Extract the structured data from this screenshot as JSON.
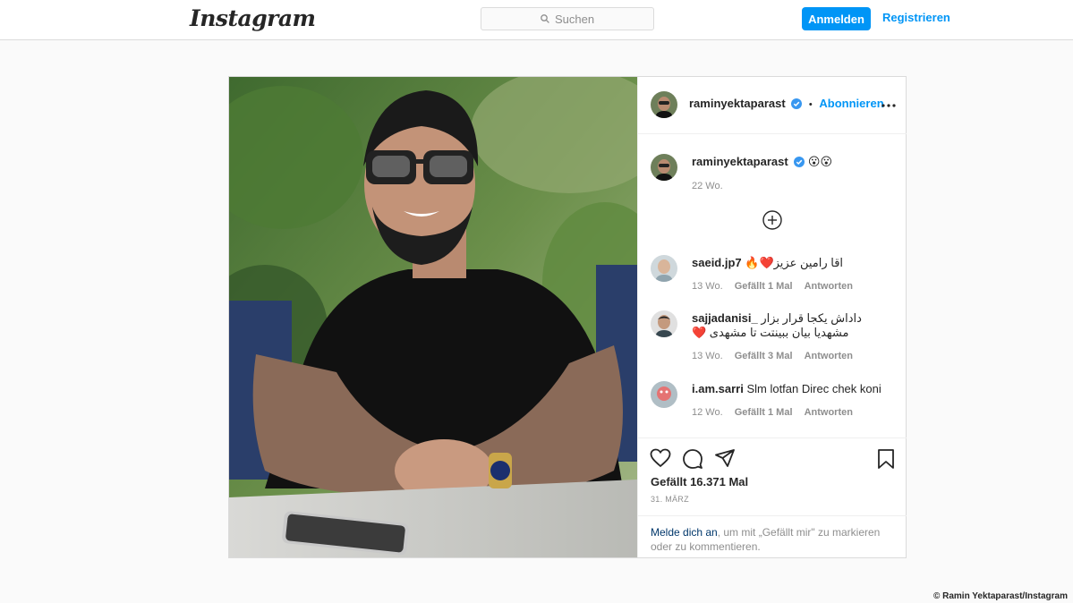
{
  "header": {
    "logo": "Instagram",
    "search_placeholder": "Suchen",
    "login_label": "Anmelden",
    "register_label": "Registrieren"
  },
  "post": {
    "author": "raminyektaparast",
    "follow_label": "Abonnieren",
    "caption_emojis": "😮😮",
    "caption_age": "22 Wo.",
    "comments": [
      {
        "user": "saeid.jp7",
        "text": "اقا رامین عزیز❤️🔥",
        "age": "13 Wo.",
        "likes": "Gefällt 1 Mal",
        "reply": "Antworten"
      },
      {
        "user": "sajjadanisi_",
        "text": "داداش یکجا قرار بزار مشهدیا بیان ببینتت تا مشهدی ❤️",
        "age": "13 Wo.",
        "likes": "Gefällt 3 Mal",
        "reply": "Antworten"
      },
      {
        "user": "i.am.sarri",
        "text": "Slm lotfan Direc chek koni",
        "age": "12 Wo.",
        "likes": "Gefällt 1 Mal",
        "reply": "Antworten"
      }
    ],
    "likes_text": "Gefällt 16.371 Mal",
    "date": "31. MÄRZ",
    "login_note_link": "Melde dich an",
    "login_note_rest": ", um mit „Gefällt mir\" zu markieren oder zu kommentieren."
  },
  "credit": "© Ramin Yektaparast/Instagram",
  "colors": {
    "accent": "#0095f6",
    "verified": "#3897f0",
    "heart": "#ed4956"
  }
}
